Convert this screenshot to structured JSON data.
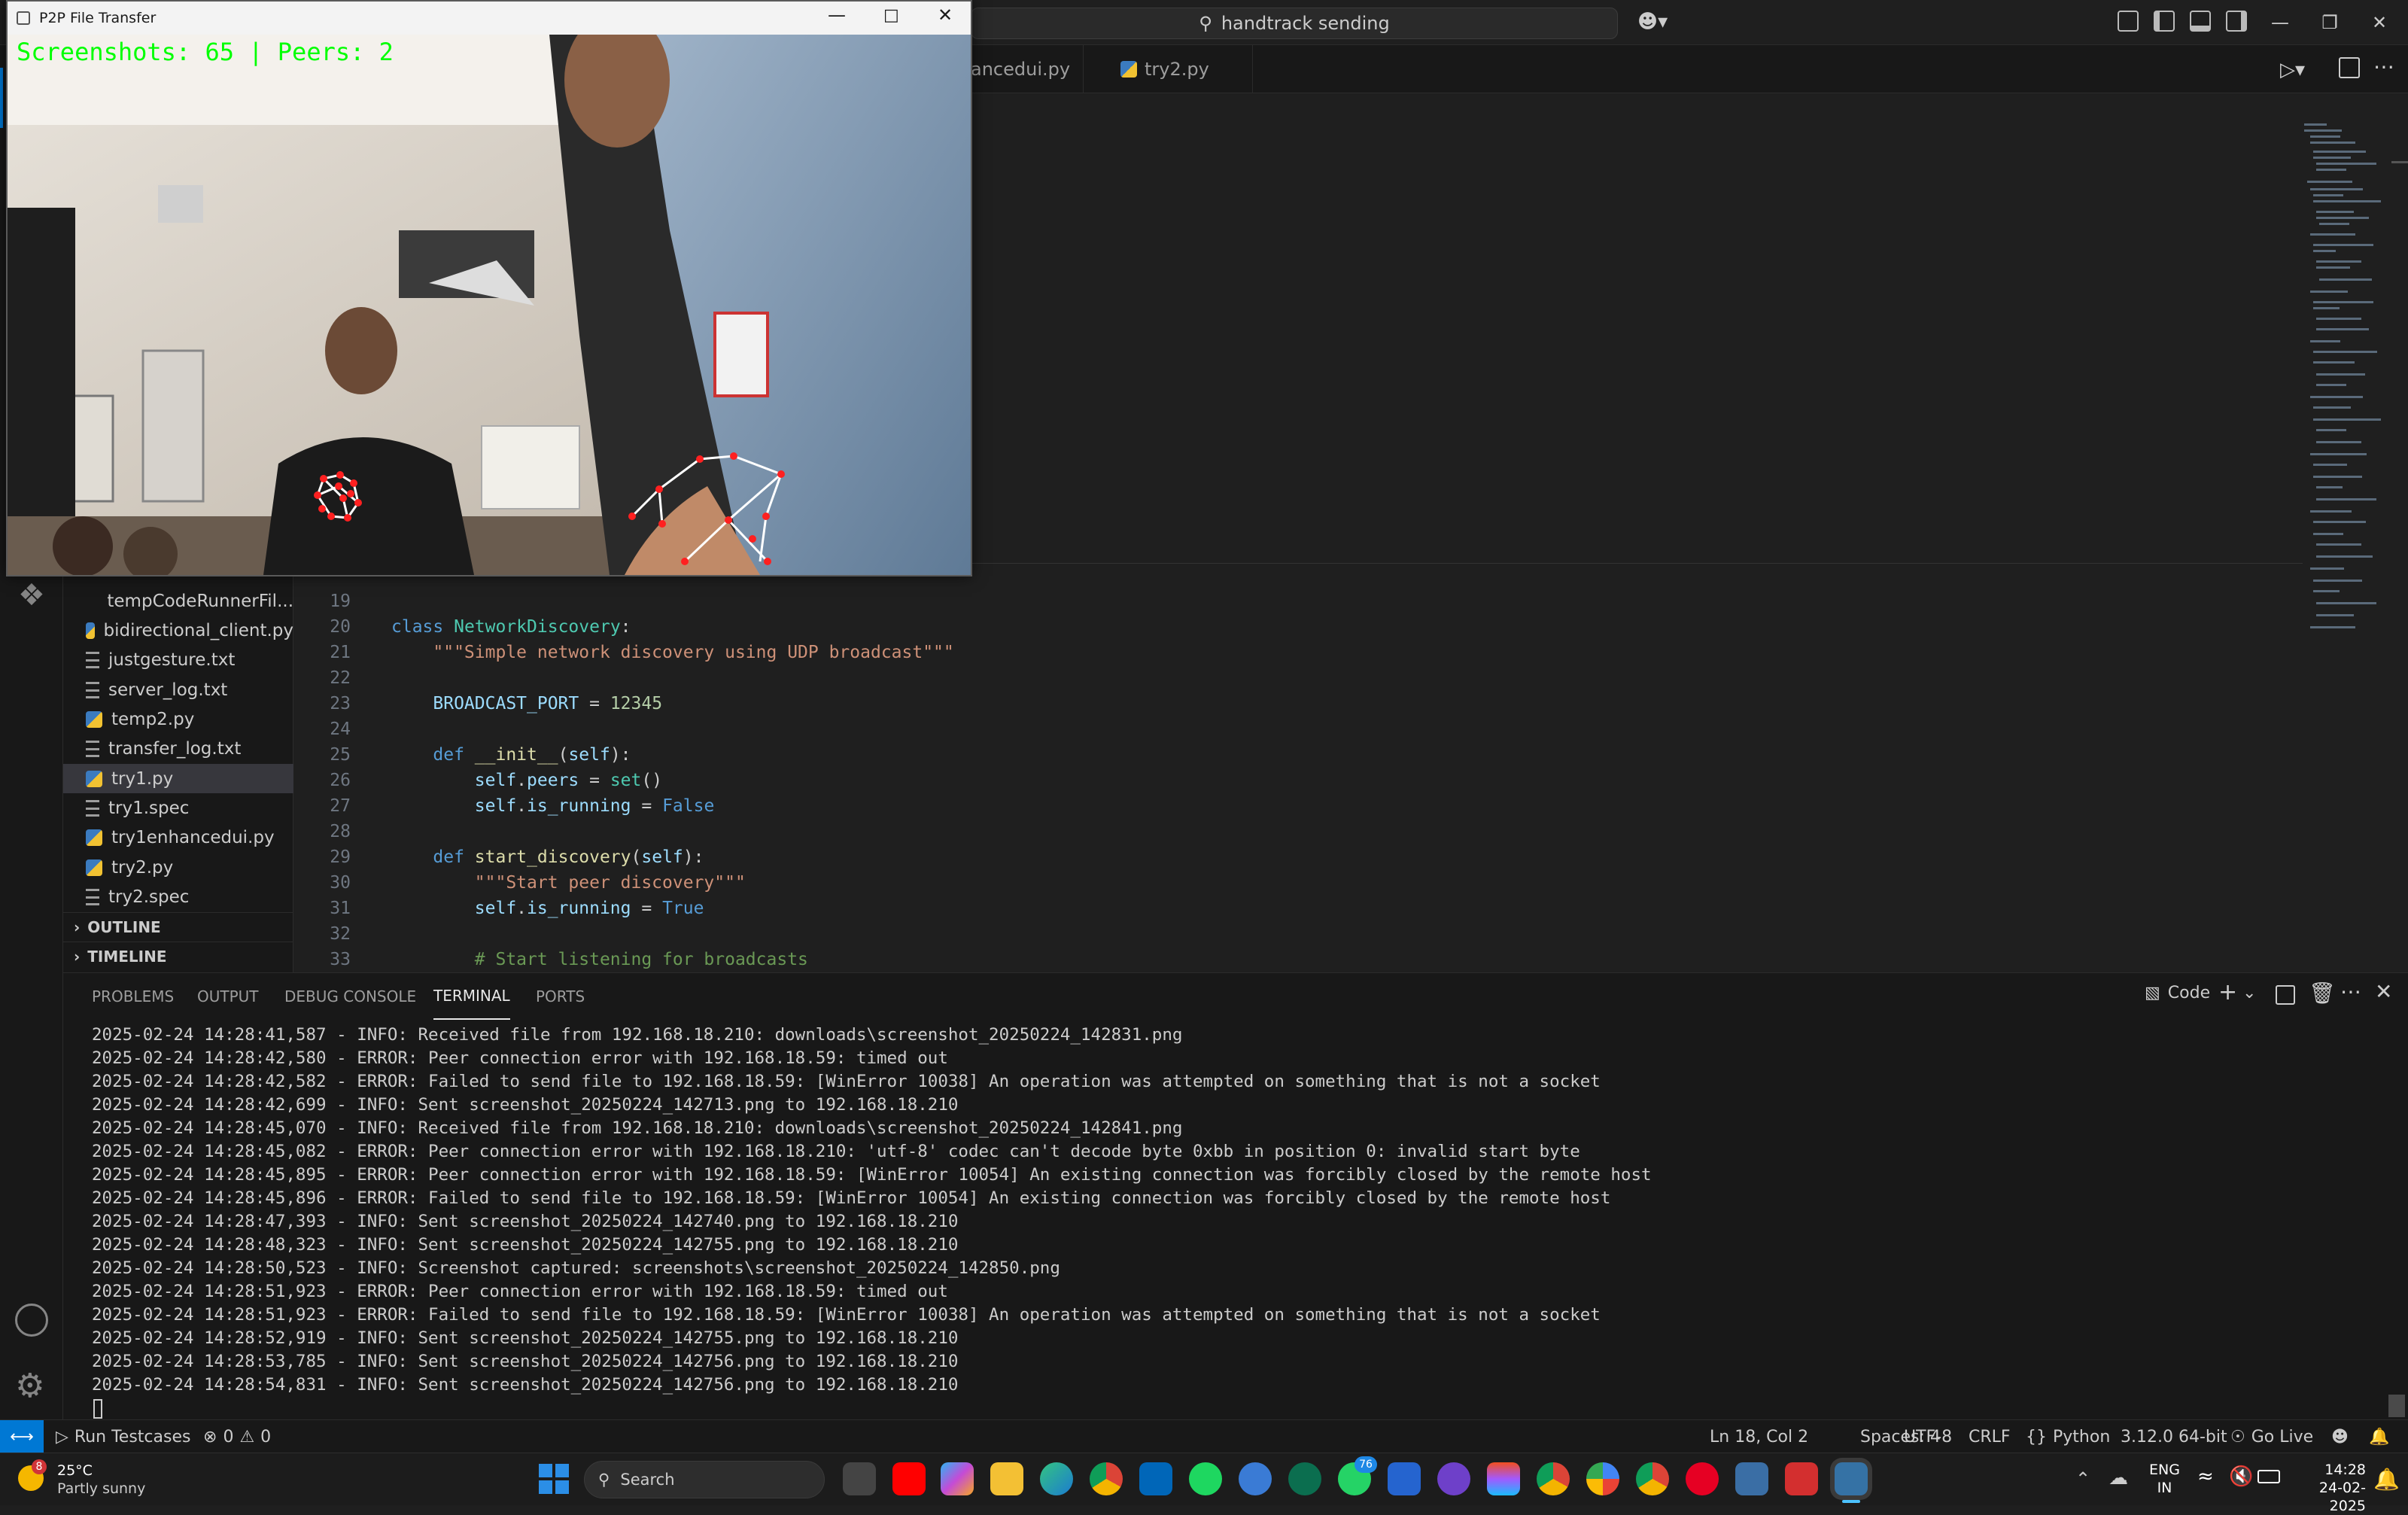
{
  "command_center": {
    "text": "handtrack sending"
  },
  "editor_tabs": [
    {
      "label": "ancedui.py"
    },
    {
      "label": "try2.py"
    }
  ],
  "explorer": {
    "partial_item": "tempCodeRunnerFil...",
    "files": [
      {
        "label": "bidirectional_client.py",
        "type": "py"
      },
      {
        "label": "justgesture.txt",
        "type": "txt"
      },
      {
        "label": "server_log.txt",
        "type": "txt"
      },
      {
        "label": "temp2.py",
        "type": "py"
      },
      {
        "label": "transfer_log.txt",
        "type": "txt"
      },
      {
        "label": "try1.py",
        "type": "py",
        "active": true
      },
      {
        "label": "try1.spec",
        "type": "txt"
      },
      {
        "label": "try1enhancedui.py",
        "type": "py"
      },
      {
        "label": "try2.py",
        "type": "py"
      },
      {
        "label": "try2.spec",
        "type": "txt"
      }
    ],
    "outline_label": "OUTLINE",
    "timeline_label": "TIMELINE"
  },
  "code_lines": [
    {
      "n": "19",
      "t": ""
    },
    {
      "n": "20",
      "t": "class NetworkDiscovery:"
    },
    {
      "n": "21",
      "t": "    \"\"\"Simple network discovery using UDP broadcast\"\"\""
    },
    {
      "n": "22",
      "t": ""
    },
    {
      "n": "23",
      "t": "    BROADCAST_PORT = 12345"
    },
    {
      "n": "24",
      "t": ""
    },
    {
      "n": "25",
      "t": "    def __init__(self):"
    },
    {
      "n": "26",
      "t": "        self.peers = set()"
    },
    {
      "n": "27",
      "t": "        self.is_running = False"
    },
    {
      "n": "28",
      "t": ""
    },
    {
      "n": "29",
      "t": "    def start_discovery(self):"
    },
    {
      "n": "30",
      "t": "        \"\"\"Start peer discovery\"\"\""
    },
    {
      "n": "31",
      "t": "        self.is_running = True"
    },
    {
      "n": "32",
      "t": ""
    },
    {
      "n": "33",
      "t": "        # Start listening for broadcasts"
    }
  ],
  "panel": {
    "tabs": [
      "PROBLEMS",
      "OUTPUT",
      "DEBUG CONSOLE",
      "TERMINAL",
      "PORTS"
    ],
    "active_tab": "TERMINAL",
    "terminal_name": "Code",
    "terminal_lines": [
      "2025-02-24 14:28:41,587 - INFO: Received file from 192.168.18.210: downloads\\screenshot_20250224_142831.png",
      "2025-02-24 14:28:42,580 - ERROR: Peer connection error with 192.168.18.59: timed out",
      "2025-02-24 14:28:42,582 - ERROR: Failed to send file to 192.168.18.59: [WinError 10038] An operation was attempted on something that is not a socket",
      "2025-02-24 14:28:42,699 - INFO: Sent screenshot_20250224_142713.png to 192.168.18.210",
      "2025-02-24 14:28:45,070 - INFO: Received file from 192.168.18.210: downloads\\screenshot_20250224_142841.png",
      "2025-02-24 14:28:45,082 - ERROR: Peer connection error with 192.168.18.210: 'utf-8' codec can't decode byte 0xbb in position 0: invalid start byte",
      "2025-02-24 14:28:45,895 - ERROR: Peer connection error with 192.168.18.59: [WinError 10054] An existing connection was forcibly closed by the remote host",
      "2025-02-24 14:28:45,896 - ERROR: Failed to send file to 192.168.18.59: [WinError 10054] An existing connection was forcibly closed by the remote host",
      "2025-02-24 14:28:47,393 - INFO: Sent screenshot_20250224_142740.png to 192.168.18.210",
      "2025-02-24 14:28:48,323 - INFO: Sent screenshot_20250224_142755.png to 192.168.18.210",
      "2025-02-24 14:28:50,523 - INFO: Screenshot captured: screenshots\\screenshot_20250224_142850.png",
      "2025-02-24 14:28:51,923 - ERROR: Peer connection error with 192.168.18.59: timed out",
      "2025-02-24 14:28:51,923 - ERROR: Failed to send file to 192.168.18.59: [WinError 10038] An operation was attempted on something that is not a socket",
      "2025-02-24 14:28:52,919 - INFO: Sent screenshot_20250224_142755.png to 192.168.18.210",
      "2025-02-24 14:28:53,785 - INFO: Sent screenshot_20250224_142756.png to 192.168.18.210",
      "2025-02-24 14:28:54,831 - INFO: Sent screenshot_20250224_142756.png to 192.168.18.210"
    ]
  },
  "status_bar": {
    "run_testcases": "Run Testcases",
    "errors": "0",
    "warnings": "0",
    "position": "Ln 18, Col 2",
    "spaces": "Spaces: 4",
    "encoding": "UTF-8",
    "eol": "CRLF",
    "language": "Python",
    "interpreter": "3.12.0 64-bit",
    "go_live": "Go Live"
  },
  "p2p_window": {
    "title": "P2P File Transfer",
    "overlay": "Screenshots: 65 | Peers: 2"
  },
  "taskbar": {
    "weather_temp": "25°C",
    "weather_desc": "Partly sunny",
    "weather_badge": "8",
    "search_label": "Search",
    "whatsapp_badge": "76",
    "lang_top": "ENG",
    "lang_bottom": "IN",
    "time": "14:28",
    "date": "24-02-2025"
  },
  "colors": {
    "accent": "#0078d4",
    "overlay_text": "#00ff00",
    "hand_landmarks": "#ff2020"
  }
}
